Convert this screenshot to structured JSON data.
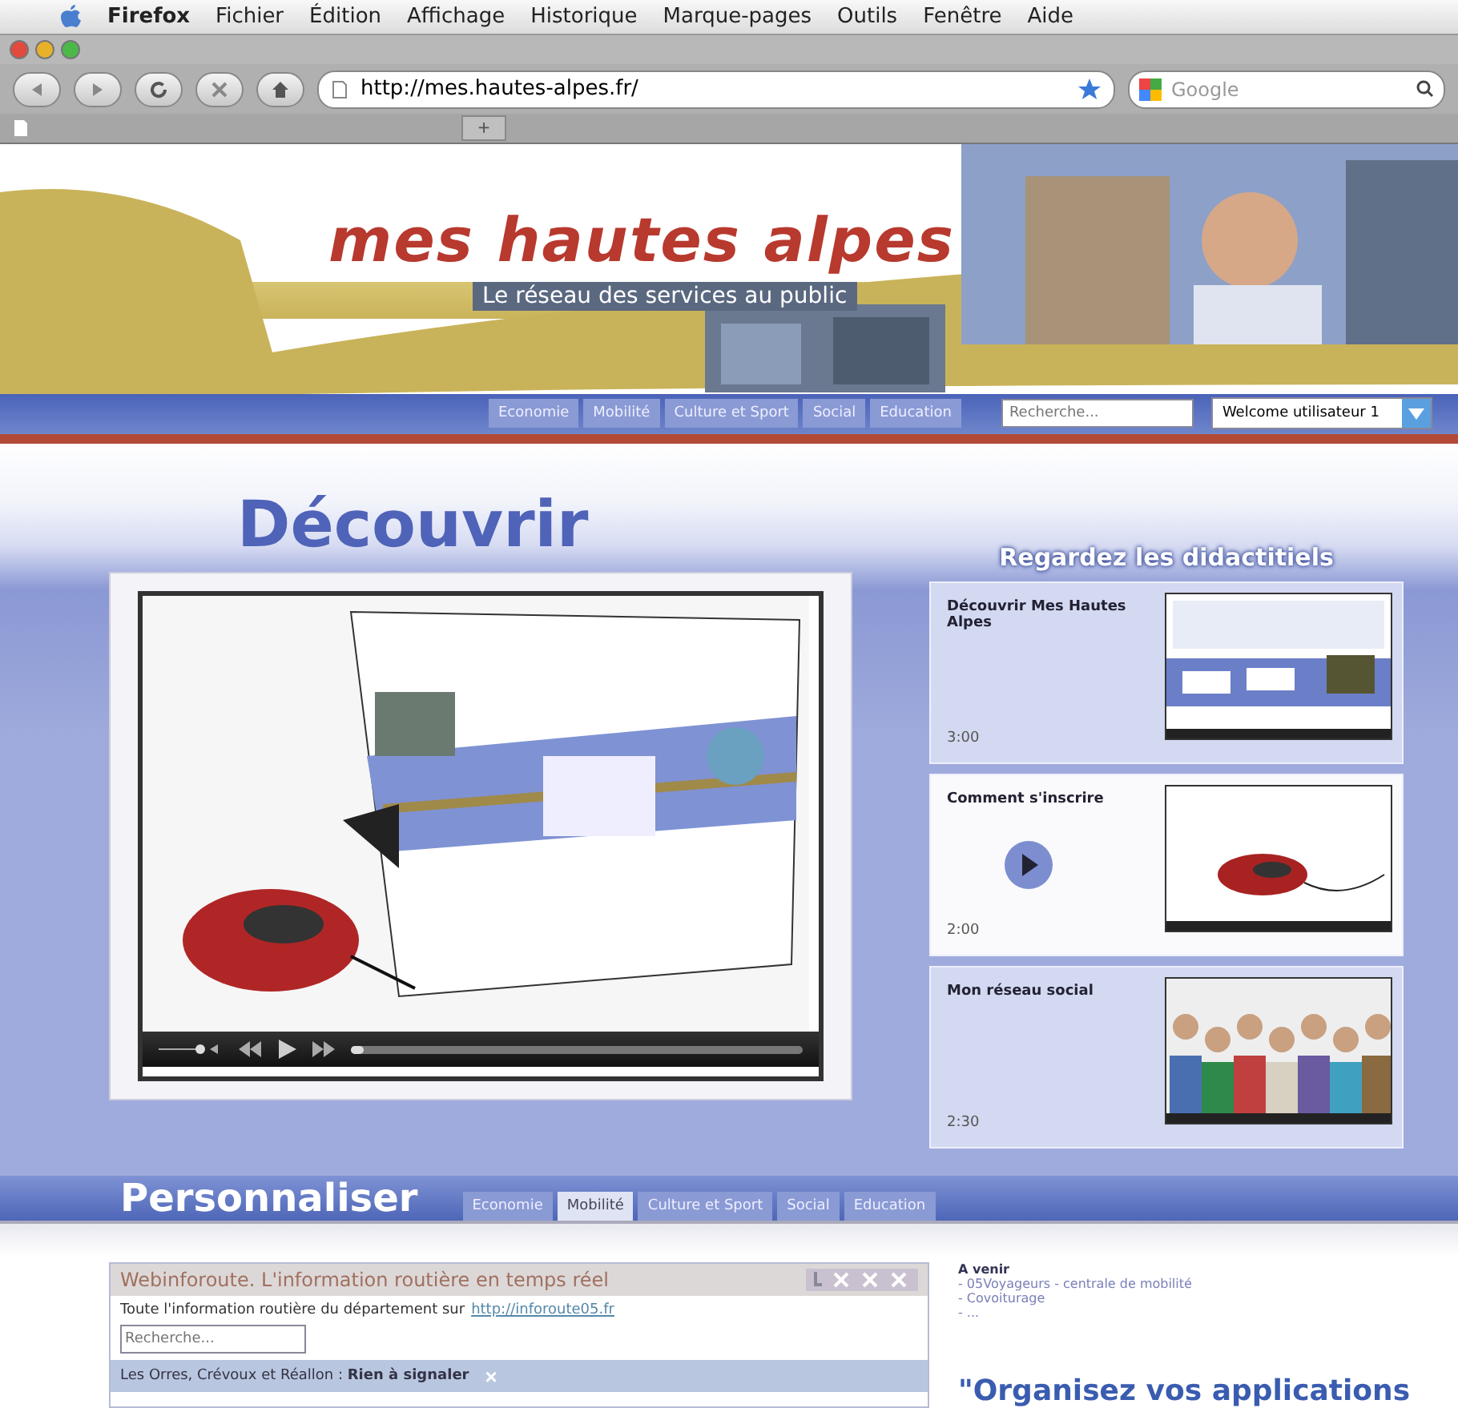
{
  "menu_bar": {
    "items": [
      {
        "label": "Firefox",
        "bold": true
      },
      {
        "label": "Fichier",
        "bold": false
      },
      {
        "label": "Édition",
        "bold": false
      },
      {
        "label": "Affichage",
        "bold": false
      },
      {
        "label": "Historique",
        "bold": false
      },
      {
        "label": "Marque-pages",
        "bold": false
      },
      {
        "label": "Outils",
        "bold": false
      },
      {
        "label": "Fenêtre",
        "bold": false
      },
      {
        "label": "Aide",
        "bold": false
      }
    ]
  },
  "toolbar": {
    "url": "http://mes.hautes-alpes.fr/",
    "search_placeholder": "Google",
    "new_tab": "+"
  },
  "header": {
    "logo": "mes hautes alpes",
    "tagline": "Le réseau des services au public"
  },
  "nav": {
    "tabs": [
      {
        "label": "Economie",
        "selected": false
      },
      {
        "label": "Mobilité",
        "selected": false
      },
      {
        "label": "Culture et Sport",
        "selected": false
      },
      {
        "label": "Social",
        "selected": false
      },
      {
        "label": "Education",
        "selected": false
      }
    ],
    "search_placeholder": "Recherche...",
    "user_select": "Welcome utilisateur 1"
  },
  "discover": {
    "title": "Découvrir",
    "video": {
      "level": 0.03
    },
    "tutorials_title": "Regardez les didactitiels",
    "tutorials": [
      {
        "title": "Découvrir Mes Hautes Alpes",
        "duration": "3:00",
        "kind": "screens",
        "highlighted": false,
        "play": false
      },
      {
        "title": "Comment s'inscrire",
        "duration": "2:00",
        "kind": "mouse",
        "highlighted": true,
        "play": true
      },
      {
        "title": "Mon réseau social",
        "duration": "2:30",
        "kind": "crowd",
        "highlighted": false,
        "play": false
      }
    ]
  },
  "personalize": {
    "title": "Personnaliser",
    "tabs": [
      {
        "label": "Economie",
        "selected": false
      },
      {
        "label": "Mobilité",
        "selected": true
      },
      {
        "label": "Culture et Sport",
        "selected": false
      },
      {
        "label": "Social",
        "selected": false
      },
      {
        "label": "Education",
        "selected": false
      }
    ]
  },
  "widget": {
    "title": "Webinforoute. L'information routière en temps réel",
    "intro": "Toute l'information routière du département sur",
    "link": "http://inforoute05.fr",
    "search_placeholder": "Recherche...",
    "status": "Les Orres, Crévoux et Réallon : **Rien à signaler**",
    "close": "×"
  },
  "upcoming": {
    "title": "A venir",
    "items": [
      "- 05Voyageurs - centrale de mobilité",
      "- Covoiturage",
      "- ..."
    ]
  },
  "promo": "\"Organisez vos applications"
}
